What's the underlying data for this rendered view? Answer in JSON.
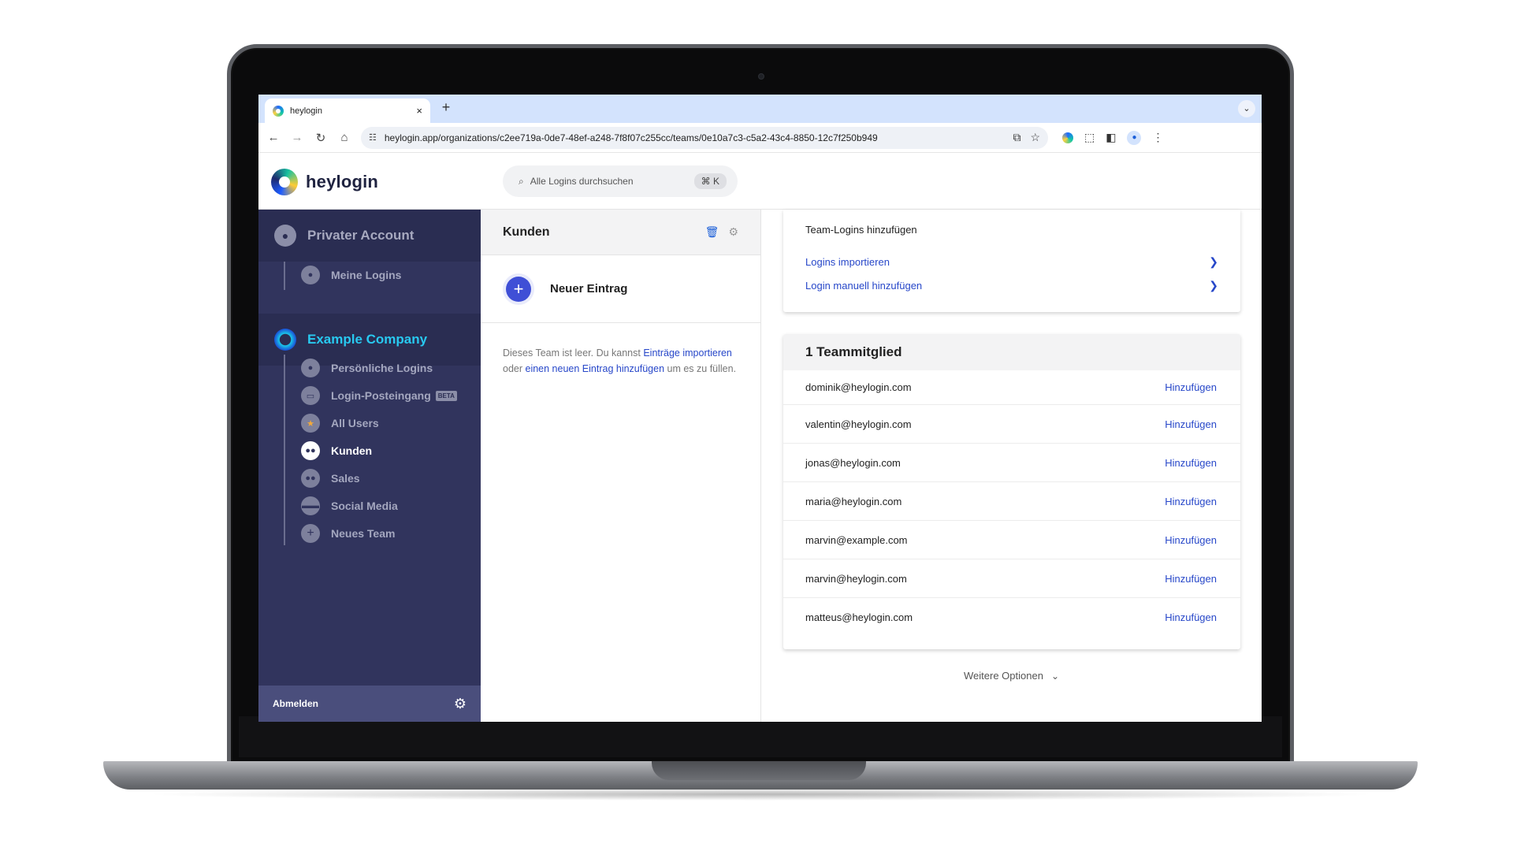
{
  "browser": {
    "tab_title": "heylogin",
    "tab_close": "×",
    "new_tab": "+",
    "tab_menu": "⌄",
    "url": "heylogin.app/organizations/c2ee719a-0de7-48ef-a248-7f8f07c255cc/teams/0e10a7c3-c5a2-43c4-8850-12c7f250b949"
  },
  "app": {
    "logo_text": "heylogin",
    "search_placeholder": "Alle Logins durchsuchen",
    "search_shortcut": "⌘ K"
  },
  "sidebar": {
    "private_account": "Privater Account",
    "private_items": [
      {
        "label": "Meine Logins",
        "icon": "user-icon"
      }
    ],
    "company_name": "Example Company",
    "company_items": [
      {
        "label": "Persönliche Logins",
        "icon": "user-icon"
      },
      {
        "label": "Login-Posteingang",
        "icon": "inbox-icon",
        "badge": "BETA"
      },
      {
        "label": "All Users",
        "icon": "star-icon"
      },
      {
        "label": "Kunden",
        "icon": "group-icon",
        "active": true
      },
      {
        "label": "Sales",
        "icon": "group-icon"
      },
      {
        "label": "Social Media",
        "icon": "sunglasses-icon"
      },
      {
        "label": "Neues Team",
        "icon": "plus-icon"
      }
    ],
    "logout": "Abmelden"
  },
  "team_panel": {
    "title": "Kunden",
    "new_entry": "Neuer Eintrag",
    "empty_text_1": "Dieses Team ist leer. Du kannst ",
    "empty_link_1": "Einträge importieren",
    "empty_text_2": " oder ",
    "empty_link_2": "einen neuen Eintrag hinzufügen",
    "empty_text_3": " um es zu füllen."
  },
  "detail": {
    "add_logins_title": "Team-Logins hinzufügen",
    "import_logins": "Logins importieren",
    "add_manually": "Login manuell hinzufügen",
    "members_title": "1 Teammitglied",
    "add_label": "Hinzufügen",
    "members": [
      "dominik@heylogin.com",
      "valentin@heylogin.com",
      "jonas@heylogin.com",
      "maria@heylogin.com",
      "marvin@example.com",
      "marvin@heylogin.com",
      "matteus@heylogin.com"
    ],
    "more_options": "Weitere Optionen"
  },
  "colors": {
    "sidebar_bg": "#31345d",
    "company_accent": "#28c9f0",
    "link_blue": "#2747c9",
    "plus_button": "#3f4fd6"
  }
}
